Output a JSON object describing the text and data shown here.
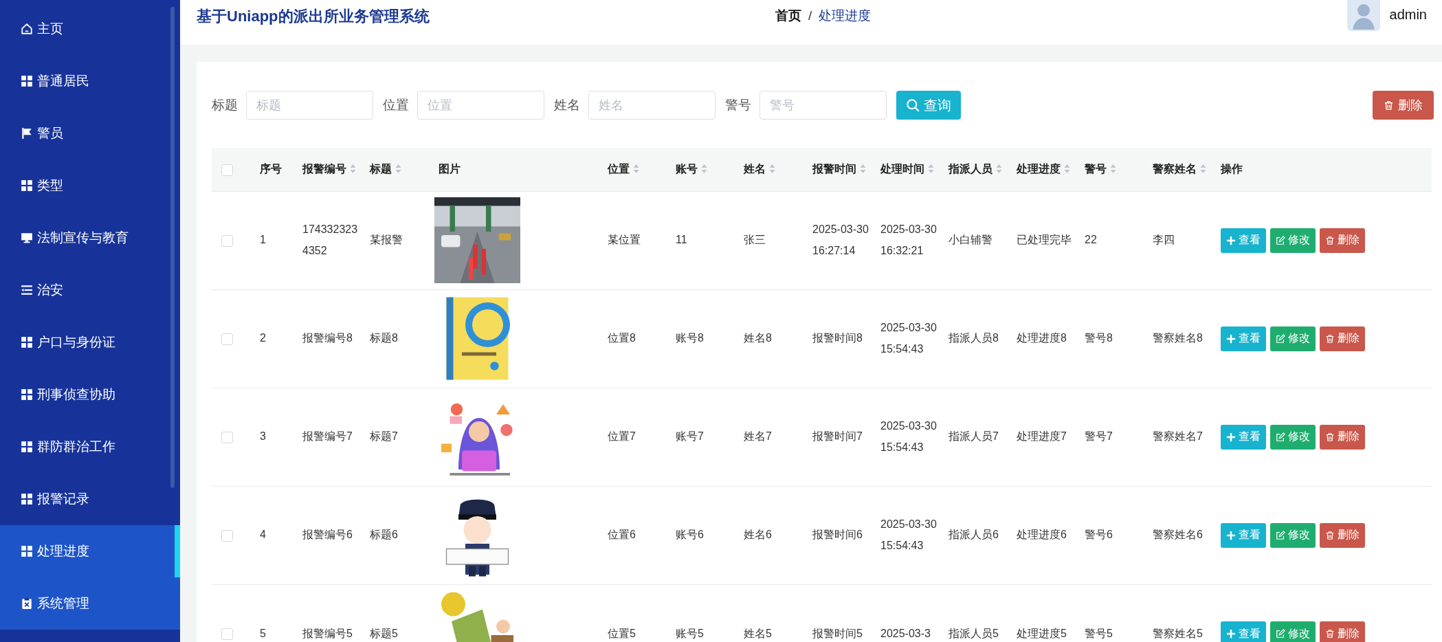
{
  "sidebar": {
    "items": [
      {
        "label": "主页",
        "selected": false,
        "hovered": false
      },
      {
        "label": "普通居民",
        "selected": false,
        "hovered": false
      },
      {
        "label": "警员",
        "selected": false,
        "hovered": false
      },
      {
        "label": "类型",
        "selected": false,
        "hovered": false
      },
      {
        "label": "法制宣传与教育",
        "selected": false,
        "hovered": false
      },
      {
        "label": "治安",
        "selected": false,
        "hovered": false
      },
      {
        "label": "户口与身份证",
        "selected": false,
        "hovered": false
      },
      {
        "label": "刑事侦查协助",
        "selected": false,
        "hovered": false
      },
      {
        "label": "群防群治工作",
        "selected": false,
        "hovered": false
      },
      {
        "label": "报警记录",
        "selected": false,
        "hovered": false
      },
      {
        "label": "处理进度",
        "selected": true,
        "hovered": false
      },
      {
        "label": "系统管理",
        "selected": false,
        "hovered": true
      }
    ]
  },
  "header": {
    "title": "基于Uniapp的派出所业务管理系统",
    "breadcrumb_separator": "/",
    "breadcrumb": [
      {
        "label": "首页",
        "current": false
      },
      {
        "label": "处理进度",
        "current": true
      }
    ],
    "user": "admin"
  },
  "filters": [
    {
      "label": "标题",
      "placeholder": "标题"
    },
    {
      "label": "位置",
      "placeholder": "位置"
    },
    {
      "label": "姓名",
      "placeholder": "姓名"
    },
    {
      "label": "警号",
      "placeholder": "警号"
    }
  ],
  "search_button": "查询",
  "delete_button": "删除",
  "table": {
    "select_all_checked": false,
    "columns": [
      {
        "label": "序号",
        "sortable": false
      },
      {
        "label": "报警编号",
        "sortable": true
      },
      {
        "label": "标题",
        "sortable": true
      },
      {
        "label": "图片",
        "sortable": false
      },
      {
        "label": "位置",
        "sortable": true
      },
      {
        "label": "账号",
        "sortable": true
      },
      {
        "label": "姓名",
        "sortable": true
      },
      {
        "label": "报警时间",
        "sortable": true
      },
      {
        "label": "处理时间",
        "sortable": true
      },
      {
        "label": "指派人员",
        "sortable": true
      },
      {
        "label": "处理进度",
        "sortable": true
      },
      {
        "label": "警号",
        "sortable": true
      },
      {
        "label": "警察姓名",
        "sortable": true
      },
      {
        "label": "操作",
        "sortable": false
      }
    ],
    "rows": [
      {
        "checked": false,
        "cells": [
          "1",
          "1743323234352",
          "某报警",
          {
            "kind": "picture"
          },
          "某位置",
          "11",
          "张三",
          "2025-03-30 16:27:14",
          "2025-03-30 16:32:21",
          "小白辅警",
          "已处理完毕",
          "22",
          "李四"
        ],
        "actions": [
          "查看",
          "修改",
          "删除"
        ]
      },
      {
        "checked": false,
        "cells": [
          "2",
          "报警编号8",
          "标题8",
          {
            "kind": "picture"
          },
          "位置8",
          "账号8",
          "姓名8",
          "报警时间8",
          "2025-03-30 15:54:43",
          "指派人员8",
          "处理进度8",
          "警号8",
          "警察姓名8"
        ],
        "actions": [
          "查看",
          "修改",
          "删除"
        ]
      },
      {
        "checked": false,
        "cells": [
          "3",
          "报警编号7",
          "标题7",
          {
            "kind": "picture"
          },
          "位置7",
          "账号7",
          "姓名7",
          "报警时间7",
          "2025-03-30 15:54:43",
          "指派人员7",
          "处理进度7",
          "警号7",
          "警察姓名7"
        ],
        "actions": [
          "查看",
          "修改",
          "删除"
        ]
      },
      {
        "checked": false,
        "cells": [
          "4",
          "报警编号6",
          "标题6",
          {
            "kind": "picture"
          },
          "位置6",
          "账号6",
          "姓名6",
          "报警时间6",
          "2025-03-30 15:54:43",
          "指派人员6",
          "处理进度6",
          "警号6",
          "警察姓名6"
        ],
        "actions": [
          "查看",
          "修改",
          "删除"
        ]
      },
      {
        "checked": false,
        "cells": [
          "5",
          "报警编号5",
          "标题5",
          {
            "kind": "picture"
          },
          "位置5",
          "账号5",
          "姓名5",
          "报警时间5",
          "2025-03-3",
          "指派人员5",
          "处理进度5",
          "警号5",
          "警察姓名5"
        ],
        "actions": [
          "查看",
          "修改",
          "删除"
        ]
      }
    ]
  }
}
